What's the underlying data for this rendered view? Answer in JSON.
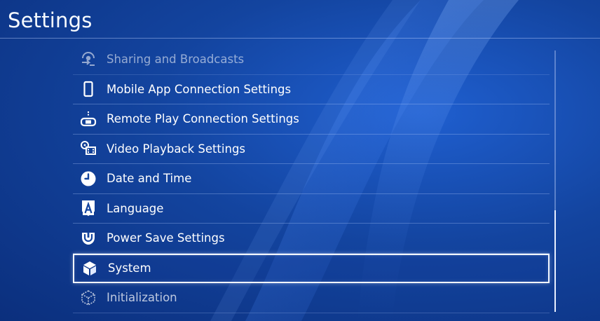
{
  "header": {
    "title": "Settings"
  },
  "menu": {
    "items": [
      {
        "label": "Sharing and Broadcasts",
        "icon": "share-broadcast-icon",
        "state": "faded"
      },
      {
        "label": "Mobile App Connection Settings",
        "icon": "mobile-phone-icon",
        "state": "normal"
      },
      {
        "label": "Remote Play Connection Settings",
        "icon": "remote-play-icon",
        "state": "normal"
      },
      {
        "label": "Video Playback Settings",
        "icon": "film-icon",
        "state": "normal"
      },
      {
        "label": "Date and Time",
        "icon": "clock-icon",
        "state": "normal"
      },
      {
        "label": "Language",
        "icon": "language-icon",
        "state": "normal"
      },
      {
        "label": "Power Save Settings",
        "icon": "power-save-icon",
        "state": "normal"
      },
      {
        "label": "System",
        "icon": "cube-icon",
        "state": "selected"
      },
      {
        "label": "Initialization",
        "icon": "cube-outline-icon",
        "state": "dim"
      }
    ]
  },
  "colors": {
    "background": "#13449f",
    "text": "#ffffff",
    "selection_border": "#f2f6ff",
    "divider": "#aac3f5"
  }
}
